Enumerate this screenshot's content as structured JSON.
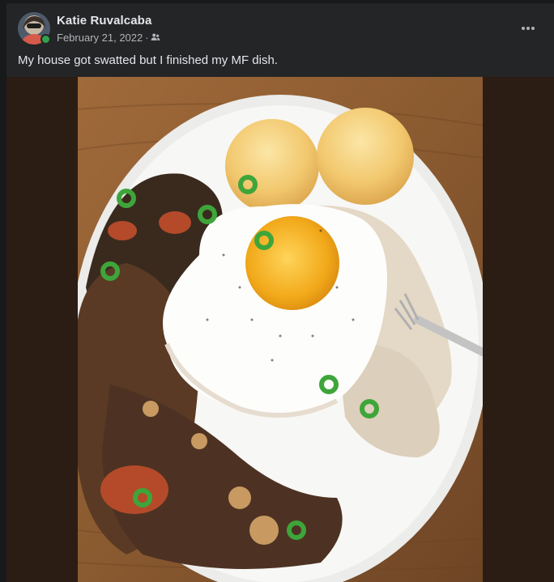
{
  "post": {
    "author": "Katie Ruvalcaba",
    "date": "February 21, 2022",
    "separator": "·",
    "audience_icon": "friends-icon",
    "menu_icon": "more-horizontal-icon",
    "caption": "My house got swatted but I finished my MF dish.",
    "online_status_color": "#31a24c"
  },
  "colors": {
    "page_bg": "#18191a",
    "card_bg": "#242526",
    "primary_text": "#e4e6eb",
    "secondary_text": "#b0b3b8",
    "media_letterbox": "#2b1d14"
  }
}
